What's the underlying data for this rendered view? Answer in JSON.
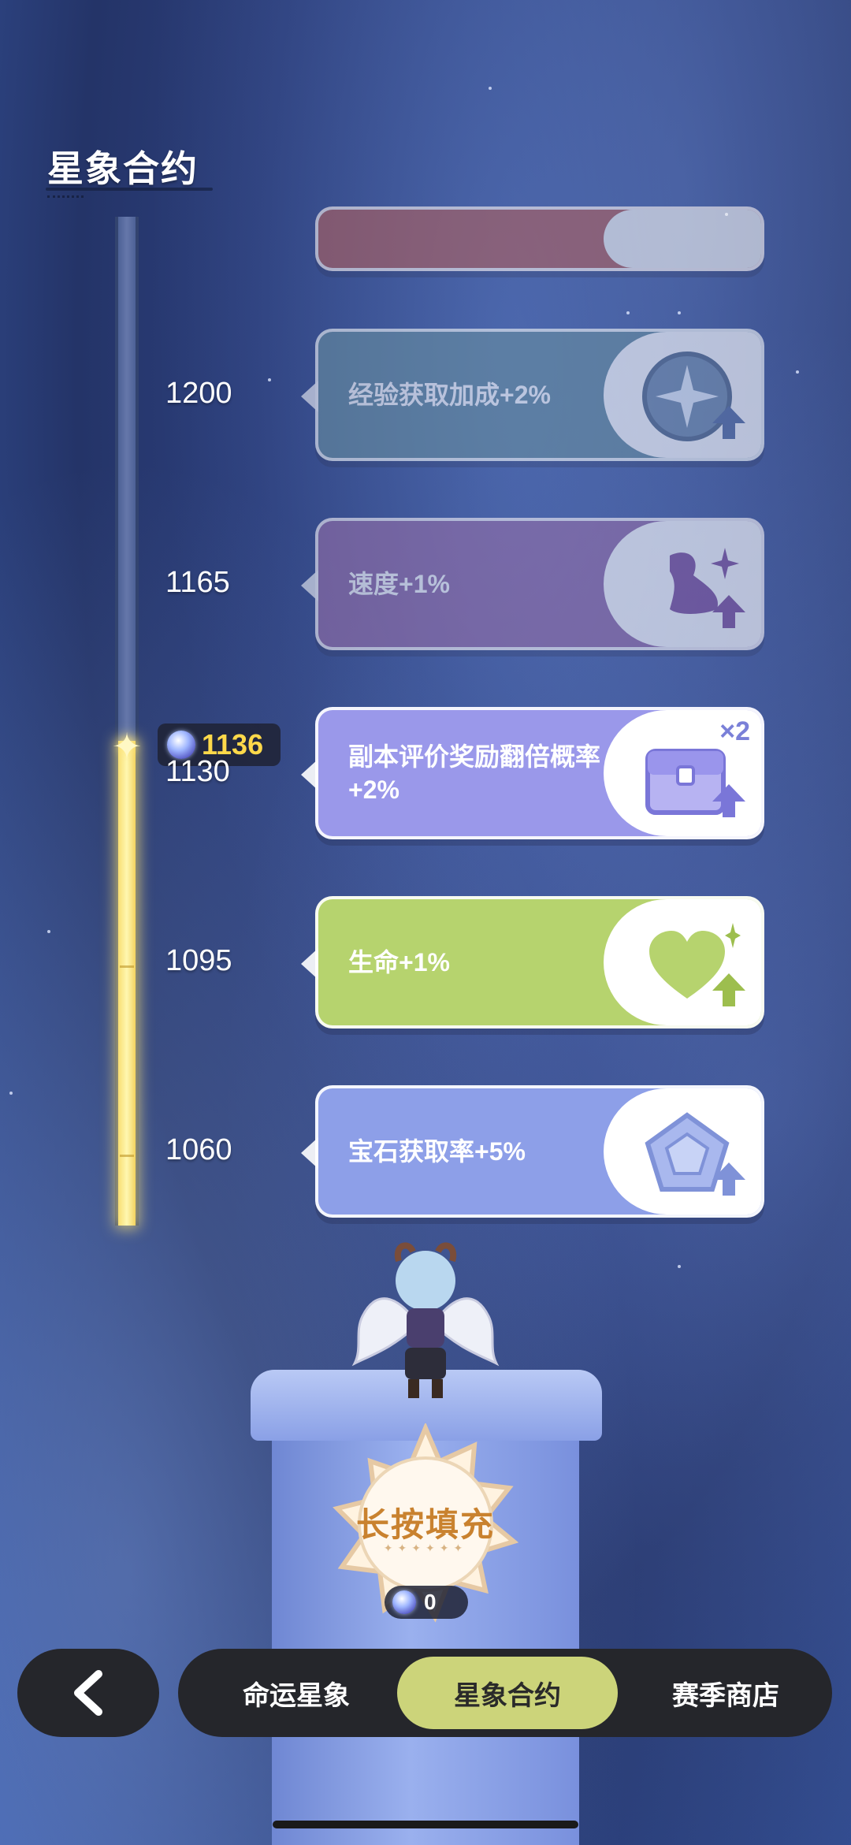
{
  "page_title": "星象合约",
  "current_points": "1136",
  "rewards": [
    {
      "threshold": "1200",
      "label": "经验获取加成+2%",
      "icon": "exp-boost-star-icon",
      "unlocked": false,
      "color": "#5d8fa8"
    },
    {
      "threshold": "1165",
      "label": "速度+1%",
      "icon": "speed-boot-icon",
      "unlocked": false,
      "color": "#9c6ab7"
    },
    {
      "threshold": "1130",
      "label": "副本评价奖励翻倍概率+2%",
      "badge": "×2",
      "icon": "treasure-chest-icon",
      "unlocked": true,
      "color": "#9a98ea"
    },
    {
      "threshold": "1095",
      "label": "生命+1%",
      "icon": "heart-icon",
      "unlocked": true,
      "color": "#b6d36e"
    },
    {
      "threshold": "1060",
      "label": "宝石获取率+5%",
      "icon": "gem-icon",
      "unlocked": true,
      "color": "#8d9fe8"
    }
  ],
  "fill_button": {
    "label": "长按填充"
  },
  "material": {
    "count": "0",
    "icon": "star-gem-icon"
  },
  "nav": {
    "back_icon": "chevron-left-icon",
    "tabs": [
      {
        "label": "命运星象",
        "active": false
      },
      {
        "label": "星象合约",
        "active": true
      },
      {
        "label": "赛季商店",
        "active": false
      }
    ],
    "active_color": "#ccd47a"
  }
}
